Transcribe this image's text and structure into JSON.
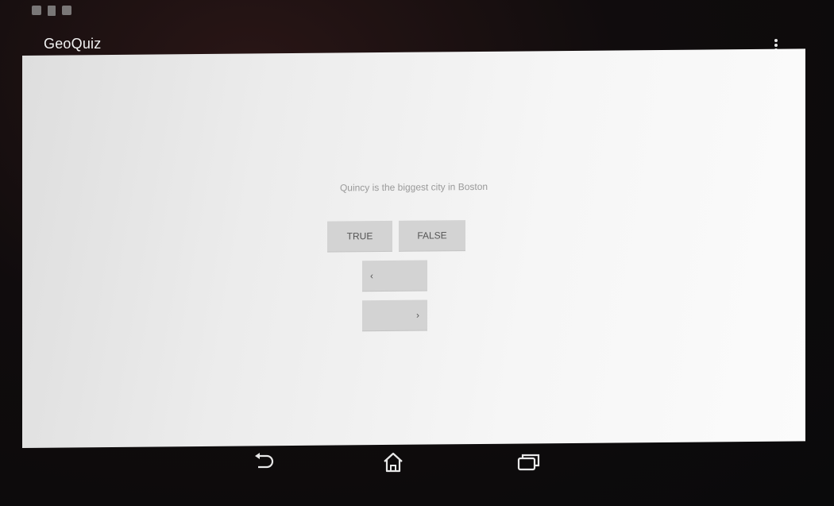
{
  "app": {
    "title": "GeoQuiz"
  },
  "status_bar": {
    "icons": [
      "gallery-icon",
      "sd-card-icon",
      "download-icon"
    ]
  },
  "action_bar": {
    "overflow_icon": "overflow-menu-icon"
  },
  "quiz": {
    "question": "Quincy is the biggest city in Boston",
    "true_label": "TRUE",
    "false_label": "FALSE",
    "prev_label": "‹",
    "next_label": "›"
  },
  "nav_bar": {
    "icons": [
      "back-icon",
      "home-icon",
      "recent-apps-icon"
    ]
  },
  "colors": {
    "screen_bg": "#f3f3f3",
    "button_bg": "#d3d3d3",
    "text_gray": "#9a9a9a",
    "bezel": "#0c0b0c"
  }
}
